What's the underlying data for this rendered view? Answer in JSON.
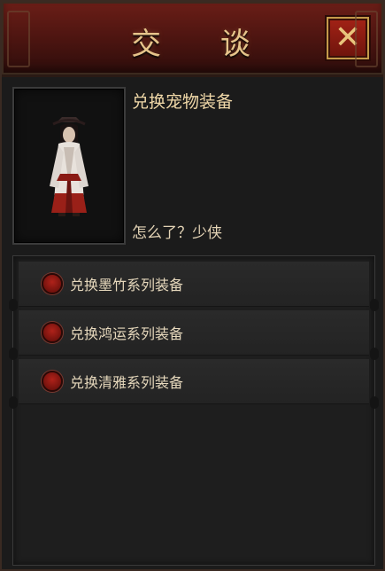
{
  "dialog": {
    "title": "交 谈",
    "close_label": "✕"
  },
  "npc": {
    "name": "兑换宠物装备",
    "speech": "怎么了？少侠"
  },
  "options": [
    {
      "label": "兑换墨竹系列装备"
    },
    {
      "label": "兑换鸿运系列装备"
    },
    {
      "label": "兑换清雅系列装备"
    }
  ],
  "colors": {
    "title_gold": "#e6c48a",
    "title_bar": "#4a1410",
    "option_dot": "#b0221a",
    "panel_bg": "#1b1b1b"
  }
}
